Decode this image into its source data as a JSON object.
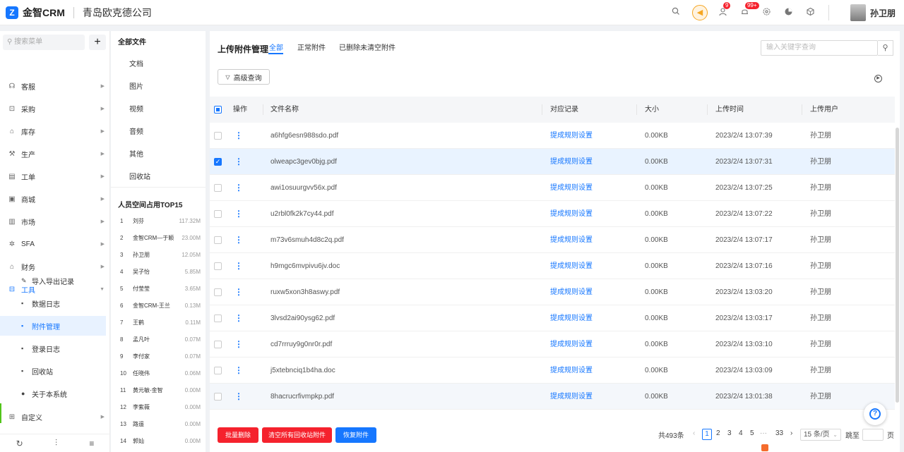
{
  "topbar": {
    "logo_glyph": "Z",
    "brand": "金智CRM",
    "company": "青岛欧克德公司",
    "message_badge": "9",
    "notice_badge": "99+",
    "username": "孙卫朋"
  },
  "sidebar": {
    "search_placeholder": "搜索菜单",
    "plus": "+",
    "items": [
      {
        "label": "客服",
        "icon": "headset-icon",
        "glyph": "☊"
      },
      {
        "label": "采购",
        "icon": "cart-icon",
        "glyph": "⊡"
      },
      {
        "label": "库存",
        "icon": "warehouse-icon",
        "glyph": "⌂"
      },
      {
        "label": "生产",
        "icon": "factory-icon",
        "glyph": "⚒"
      },
      {
        "label": "工单",
        "icon": "ticket-icon",
        "glyph": "▤"
      },
      {
        "label": "商城",
        "icon": "shop-icon",
        "glyph": "▣"
      },
      {
        "label": "市场",
        "icon": "market-icon",
        "glyph": "▥"
      },
      {
        "label": "SFA",
        "icon": "sfa-icon",
        "glyph": "✲"
      },
      {
        "label": "财务",
        "icon": "finance-icon",
        "glyph": "⌂"
      },
      {
        "label": "工具",
        "icon": "toolbox-icon",
        "glyph": "⊟"
      }
    ],
    "sub_items": [
      {
        "label": "导入导出记录",
        "icon": "import-export-icon",
        "glyph": "✎"
      },
      {
        "label": "数据日志",
        "icon": "log-icon",
        "glyph": "▪"
      },
      {
        "label": "附件管理",
        "icon": "attachment-icon",
        "glyph": "▪"
      },
      {
        "label": "登录日志",
        "icon": "login-log-icon",
        "glyph": "▪"
      },
      {
        "label": "回收站",
        "icon": "recycle-icon",
        "glyph": "▪"
      },
      {
        "label": "关于本系统",
        "icon": "info-icon",
        "glyph": "●"
      }
    ],
    "custom": {
      "label": "自定义",
      "icon": "custom-icon",
      "glyph": "⊞"
    },
    "bottom": [
      {
        "icon": "history-icon",
        "glyph": "↻"
      },
      {
        "icon": "sliders-icon",
        "glyph": "⫶"
      },
      {
        "icon": "collapse-menu-icon",
        "glyph": "≡"
      }
    ]
  },
  "categories": {
    "title": "全部文件",
    "items": [
      "文档",
      "图片",
      "视频",
      "音频",
      "其他",
      "回收站"
    ],
    "top_title": "人员空间占用TOP15",
    "ranking": [
      {
        "rank": "1",
        "name": "刘芬",
        "size": "117.32M"
      },
      {
        "rank": "2",
        "name": "金智CRM—于颖",
        "size": "23.00M"
      },
      {
        "rank": "3",
        "name": "孙卫朋",
        "size": "12.05M"
      },
      {
        "rank": "4",
        "name": "吴子怡",
        "size": "5.85M"
      },
      {
        "rank": "5",
        "name": "付莹莹",
        "size": "3.65M"
      },
      {
        "rank": "6",
        "name": "金智CRM-王兰",
        "size": "0.13M"
      },
      {
        "rank": "7",
        "name": "王鹤",
        "size": "0.11M"
      },
      {
        "rank": "8",
        "name": "孟凡叶",
        "size": "0.07M"
      },
      {
        "rank": "9",
        "name": "李付家",
        "size": "0.07M"
      },
      {
        "rank": "10",
        "name": "任晓伟",
        "size": "0.06M"
      },
      {
        "rank": "11",
        "name": "黄元敏-金智",
        "size": "0.00M"
      },
      {
        "rank": "12",
        "name": "李紫薇",
        "size": "0.00M"
      },
      {
        "rank": "13",
        "name": "路遥",
        "size": "0.00M"
      },
      {
        "rank": "14",
        "name": "郭灿",
        "size": "0.00M"
      }
    ]
  },
  "main": {
    "title": "上传附件管理",
    "tabs": [
      "全部",
      "正常附件",
      "已删除未清空附件"
    ],
    "search_placeholder": "输入关键字查询",
    "advanced_query": "高级查询",
    "columns": {
      "action": "操作",
      "name": "文件名称",
      "record": "对应记录",
      "size": "大小",
      "time": "上传时间",
      "user": "上传用户"
    },
    "rows": [
      {
        "name": "a6hfg6esn988sdo.pdf",
        "record": "提成规则设置",
        "size": "0.00KB",
        "time": "2023/2/4 13:07:39",
        "user": "孙卫朋"
      },
      {
        "name": "olweapc3gev0bjg.pdf",
        "record": "提成规则设置",
        "size": "0.00KB",
        "time": "2023/2/4 13:07:31",
        "user": "孙卫朋"
      },
      {
        "name": "awi1osuurgvv56x.pdf",
        "record": "提成规则设置",
        "size": "0.00KB",
        "time": "2023/2/4 13:07:25",
        "user": "孙卫朋"
      },
      {
        "name": "u2rbl0fk2k7cy44.pdf",
        "record": "提成规则设置",
        "size": "0.00KB",
        "time": "2023/2/4 13:07:22",
        "user": "孙卫朋"
      },
      {
        "name": "m73v6smuh4d8c2q.pdf",
        "record": "提成规则设置",
        "size": "0.00KB",
        "time": "2023/2/4 13:07:17",
        "user": "孙卫朋"
      },
      {
        "name": "h9mgc6mvpivu6jv.doc",
        "record": "提成规则设置",
        "size": "0.00KB",
        "time": "2023/2/4 13:07:16",
        "user": "孙卫朋"
      },
      {
        "name": "ruxw5xon3h8aswy.pdf",
        "record": "提成规则设置",
        "size": "0.00KB",
        "time": "2023/2/4 13:03:20",
        "user": "孙卫朋"
      },
      {
        "name": "3lvsd2ai90ysg62.pdf",
        "record": "提成规则设置",
        "size": "0.00KB",
        "time": "2023/2/4 13:03:17",
        "user": "孙卫朋"
      },
      {
        "name": "cd7rrruy9g0nr0r.pdf",
        "record": "提成规则设置",
        "size": "0.00KB",
        "time": "2023/2/4 13:03:10",
        "user": "孙卫朋"
      },
      {
        "name": "j5xtebnciq1b4ha.doc",
        "record": "提成规则设置",
        "size": "0.00KB",
        "time": "2023/2/4 13:03:09",
        "user": "孙卫朋"
      },
      {
        "name": "8hacrucrfivmpkp.pdf",
        "record": "提成规则设置",
        "size": "0.00KB",
        "time": "2023/2/4 13:01:38",
        "user": "孙卫朋"
      }
    ],
    "footer": {
      "batch_delete": "批量删除",
      "clear_recycle": "清空所有回收站附件",
      "restore": "恢复附件",
      "total": "共493条",
      "pages": [
        "1",
        "2",
        "3",
        "4",
        "5",
        "···",
        "33"
      ],
      "page_size": "15 条/页",
      "goto": "跳至",
      "page_unit": "页"
    }
  },
  "colors": {
    "accent": "#1677ff",
    "danger": "#f5222d",
    "selected_row": "#e9f3ff"
  }
}
